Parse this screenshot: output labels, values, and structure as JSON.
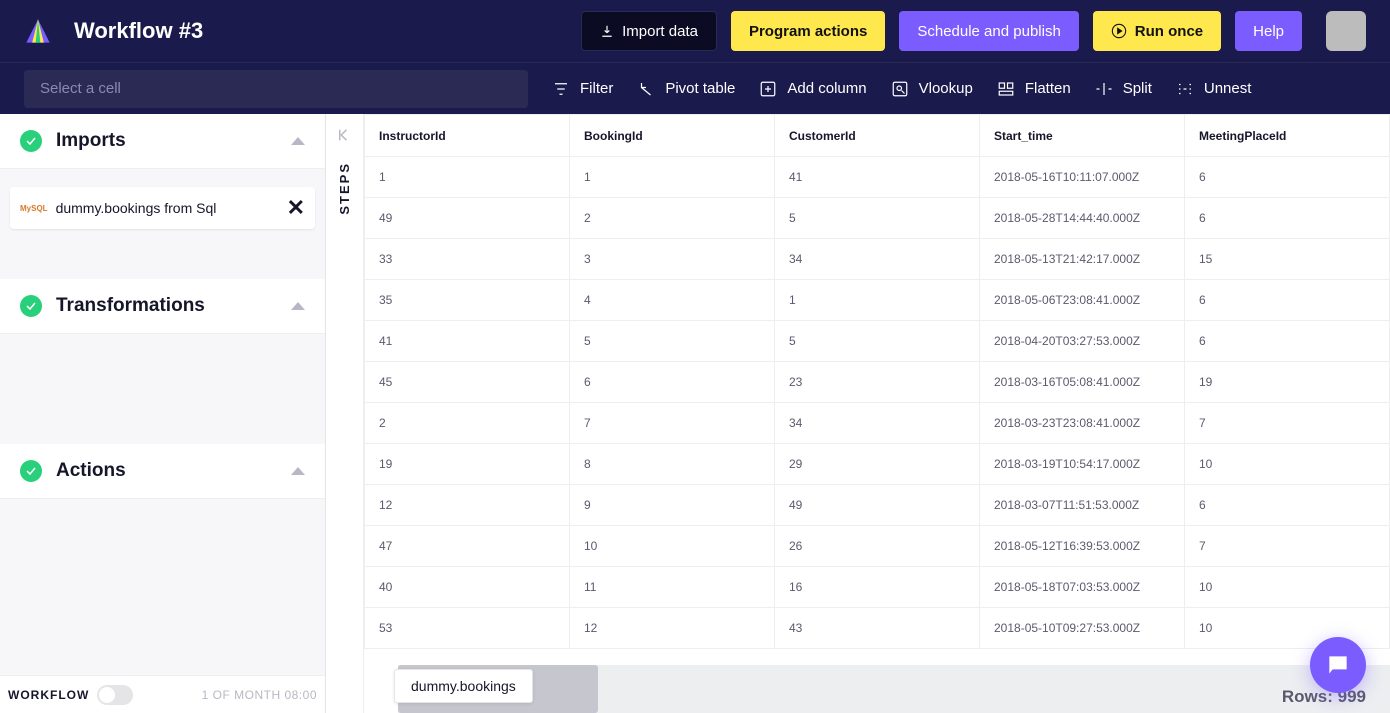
{
  "header": {
    "title": "Workflow #3",
    "import_data": "Import data",
    "program_actions": "Program actions",
    "schedule_publish": "Schedule and publish",
    "run_once": "Run once",
    "help": "Help"
  },
  "toolbar": {
    "cell_placeholder": "Select a cell",
    "filter": "Filter",
    "pivot": "Pivot table",
    "add_column": "Add column",
    "vlookup": "Vlookup",
    "flatten": "Flatten",
    "split": "Split",
    "unnest": "Unnest"
  },
  "sidebar": {
    "imports_title": "Imports",
    "transformations_title": "Transformations",
    "actions_title": "Actions",
    "import_item": "dummy.bookings from Sql",
    "mysql_badge": "MySQL",
    "workflow": "WORKFLOW",
    "schedule": "1 OF MONTH 08:00"
  },
  "steps": {
    "label": "STEPS"
  },
  "table": {
    "columns": [
      "InstructorId",
      "BookingId",
      "CustomerId",
      "Start_time",
      "MeetingPlaceId"
    ],
    "rows": [
      [
        "1",
        "1",
        "41",
        "2018-05-16T10:11:07.000Z",
        "6"
      ],
      [
        "49",
        "2",
        "5",
        "2018-05-28T14:44:40.000Z",
        "6"
      ],
      [
        "33",
        "3",
        "34",
        "2018-05-13T21:42:17.000Z",
        "15"
      ],
      [
        "35",
        "4",
        "1",
        "2018-05-06T23:08:41.000Z",
        "6"
      ],
      [
        "41",
        "5",
        "5",
        "2018-04-20T03:27:53.000Z",
        "6"
      ],
      [
        "45",
        "6",
        "23",
        "2018-03-16T05:08:41.000Z",
        "19"
      ],
      [
        "2",
        "7",
        "34",
        "2018-03-23T23:08:41.000Z",
        "7"
      ],
      [
        "19",
        "8",
        "29",
        "2018-03-19T10:54:17.000Z",
        "10"
      ],
      [
        "12",
        "9",
        "49",
        "2018-03-07T11:51:53.000Z",
        "6"
      ],
      [
        "47",
        "10",
        "26",
        "2018-05-12T16:39:53.000Z",
        "7"
      ],
      [
        "40",
        "11",
        "16",
        "2018-05-18T07:03:53.000Z",
        "10"
      ],
      [
        "53",
        "12",
        "43",
        "2018-05-10T09:27:53.000Z",
        "10"
      ]
    ]
  },
  "footer": {
    "dataset_pill": "dummy.bookings",
    "rows_label": "Rows:",
    "rows_count": "999"
  }
}
